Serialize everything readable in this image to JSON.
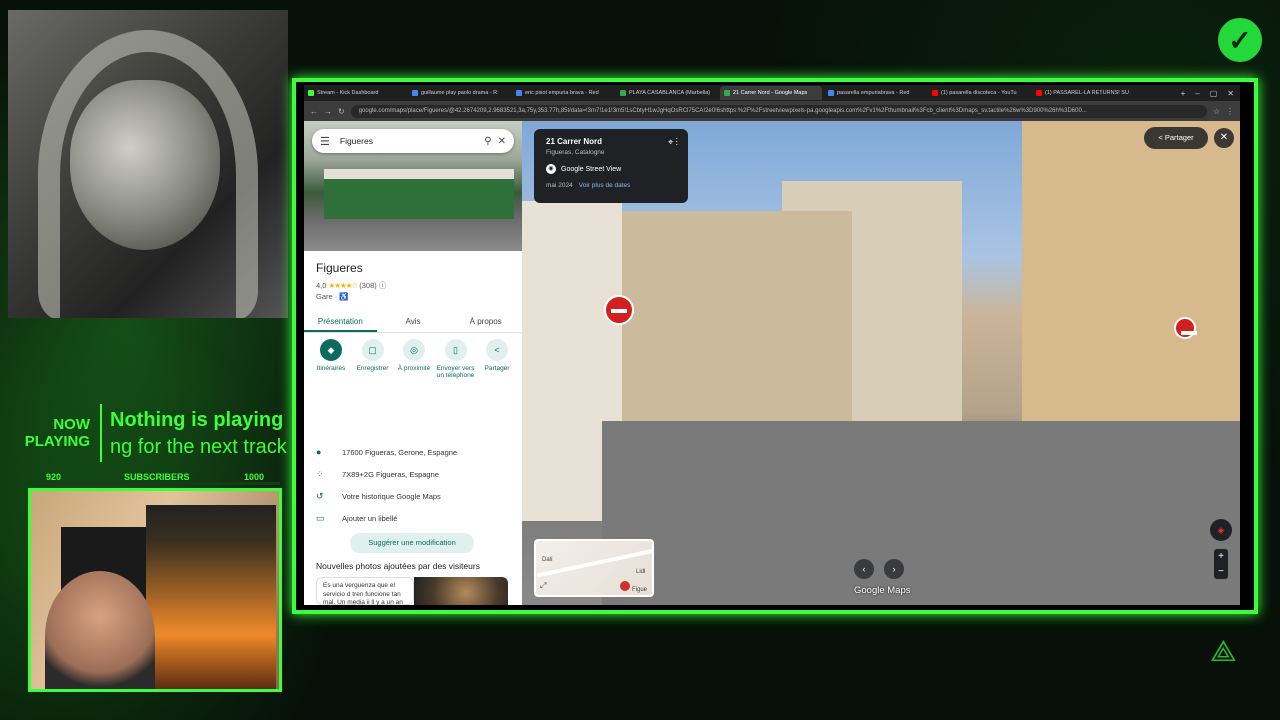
{
  "stream": {
    "now_playing_label_1": "NOW",
    "now_playing_label_2": "PLAYING",
    "now_playing_title": "Nothing is playing",
    "now_playing_sub": "ng for the next track",
    "subs_min": "920",
    "subs_label": "SUBSCRIBERS",
    "subs_max": "1000",
    "subs_progress": 0.0,
    "badge_icon": "verified-check-icon",
    "accent": "#3cff3c"
  },
  "browser": {
    "tabs": [
      {
        "label": "Stream - Kick Dashboard",
        "color": "#3cff3c"
      },
      {
        "label": "guillaume play paolo drama - R",
        "color": "#4285f4"
      },
      {
        "label": "eric pisot empuria brava - Red",
        "color": "#4285f4"
      },
      {
        "label": "PLAYA CASABLANCA (Marbella)",
        "color": "#34a853"
      },
      {
        "label": "21 Carrer Nord - Google Maps",
        "color": "#34a853",
        "active": true
      },
      {
        "label": "pasarella empuriabrava - Red",
        "color": "#4285f4"
      },
      {
        "label": "(1) pasarella discoteca - YouTu",
        "color": "#ff0000"
      },
      {
        "label": "(1) PASSAREL-LA RETURNS! SU",
        "color": "#ff0000"
      }
    ],
    "new_tab": "+",
    "url": "google.com/maps/place/Figueres/@42.2674209,2.9683521,3a,75y,353.77h,85t/data=!3m7!1e1!3m5!1sCbtyH1wJgHqOsRCl75CA!2e0!6shttps:%2F%2Fstreetviewpixels-pa.googleapis.com%2Fv1%2Fthumbnail%3Fcb_client%3Dmaps_sv.tactile%26w%3D900%26h%3D600..."
  },
  "maps": {
    "search_value": "Figueres",
    "place_name": "Figueres",
    "rating": "4,0",
    "stars": "★★★★☆",
    "review_count": "(308)",
    "category": "Gare · ♿",
    "tabs": [
      "Présentation",
      "Avis",
      "À propos"
    ],
    "actions": [
      {
        "label": "Itinéraires",
        "icon": "◆"
      },
      {
        "label": "Enregistrer",
        "icon": "▢"
      },
      {
        "label": "À proximité",
        "icon": "◎"
      },
      {
        "label": "Envoyer vers un téléphone",
        "icon": "▯"
      },
      {
        "label": "Partager",
        "icon": "<"
      }
    ],
    "info": [
      {
        "icon": "●",
        "text": "17600 Figueras, Gerone, Espagne"
      },
      {
        "icon": "⁘",
        "text": "7X89+2G Figueras, Espagne"
      },
      {
        "icon": "↺",
        "text": "Votre historique Google Maps"
      },
      {
        "icon": "▭",
        "text": "Ajouter un libellé"
      }
    ],
    "suggest": "Suggérer une modification",
    "new_photos": "Nouvelles photos ajoutées par des visiteurs",
    "review": "Es una verguenza que el servicio d tren funcione tan mal. Un media ii ll y a un an"
  },
  "streetview": {
    "title": "21 Carrer Nord",
    "subtitle": "Figueras, Catalogne",
    "source": "Google Street View",
    "date": "mai 2024",
    "more_dates": "Voir plus de dates",
    "share": "Partager",
    "logo": "Google Maps",
    "minimap_label_1": "Dalí",
    "minimap_label_2": "Lidl",
    "minimap_label_3": "Figue"
  }
}
